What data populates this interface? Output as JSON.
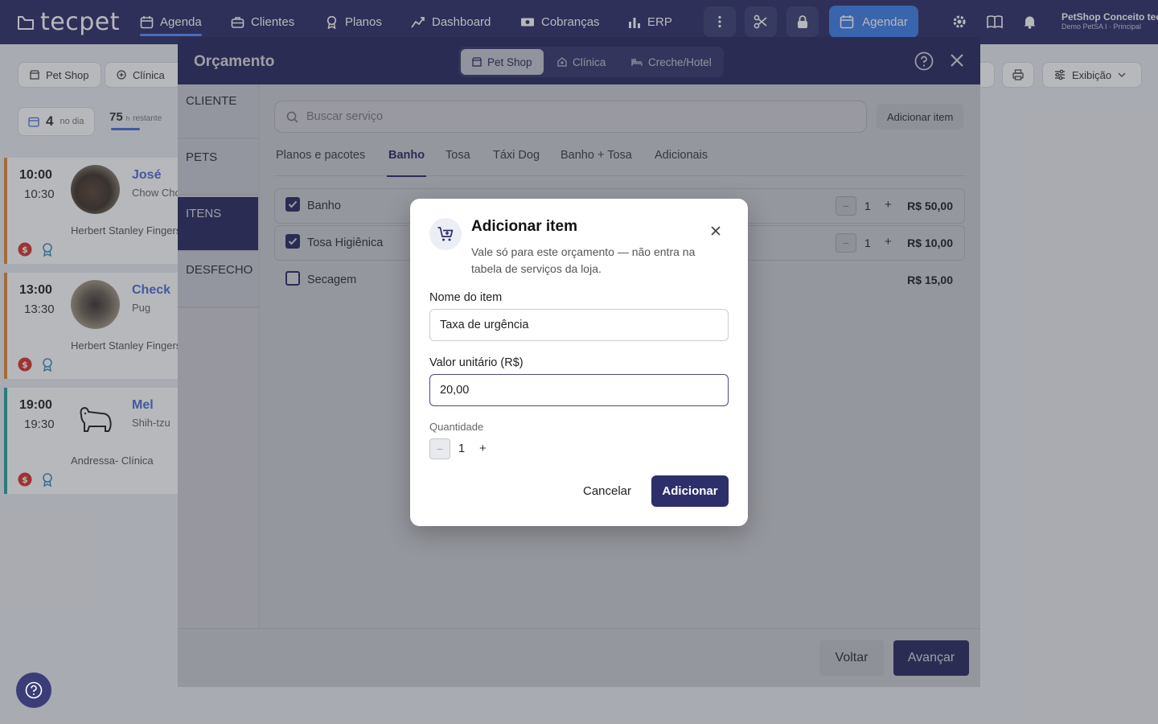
{
  "app": {
    "logo_text": "tecpet",
    "nav": [
      {
        "label": "Agenda",
        "icon": "calendar-icon",
        "active": true
      },
      {
        "label": "Clientes",
        "icon": "briefcase-icon"
      },
      {
        "label": "Planos",
        "icon": "medal-icon"
      },
      {
        "label": "Dashboard",
        "icon": "trend-icon"
      },
      {
        "label": "Cobranças",
        "icon": "money-icon"
      },
      {
        "label": "ERP",
        "icon": "bar-chart-icon"
      }
    ],
    "agendar_label": "Agendar",
    "user_name": "PetShop Conceito tecpet",
    "user_sub": "Demo PetSA I · Principal",
    "accent": "#2d2f6b"
  },
  "background": {
    "filters": {
      "petshop": "Pet Shop",
      "clinica": "Clínica",
      "exibicao": "Exibição"
    },
    "stats": {
      "day_count": "4",
      "day_label": "no dia",
      "remaining_count": "75",
      "remaining_unit": "h",
      "remaining_label": "restante"
    },
    "appointments": [
      {
        "start": "10:00",
        "end": "10:30",
        "pet": "José",
        "breed": "Chow Chow",
        "owner": "Herbert Stanley Fingers",
        "bar_color": "#e08a3c"
      },
      {
        "start": "13:00",
        "end": "13:30",
        "pet": "Check",
        "breed": "Pug",
        "owner": "Herbert Stanley Fingers",
        "bar_color": "#e08a3c"
      },
      {
        "start": "19:00",
        "end": "19:30",
        "pet": "Mel",
        "breed": "Shih-tzu",
        "owner": "Andressa- Clínica",
        "bar_color": "#2aa39a"
      }
    ]
  },
  "orcamento": {
    "title": "Orçamento",
    "segments": [
      {
        "label": "Pet Shop",
        "active": true
      },
      {
        "label": "Clínica"
      },
      {
        "label": "Creche/Hotel"
      }
    ],
    "steps": [
      "CLIENTE",
      "PETS",
      "ITENS",
      "DESFECHO"
    ],
    "active_step": "ITENS",
    "search_placeholder": "Buscar serviço",
    "add_item_label": "Adicionar item",
    "tabs": [
      "Planos e pacotes",
      "Banho",
      "Tosa",
      "Táxi Dog",
      "Banho + Tosa",
      "Adicionais"
    ],
    "active_tab": "Banho",
    "services": [
      {
        "name": "Banho",
        "checked": true,
        "qty": "1",
        "price": "R$ 50,00"
      },
      {
        "name": "Tosa Higiênica",
        "checked": true,
        "qty": "1",
        "price": "R$ 10,00"
      },
      {
        "name": "Secagem",
        "checked": false,
        "price": "R$ 15,00"
      }
    ],
    "back_label": "Voltar",
    "next_label": "Avançar"
  },
  "modal": {
    "title": "Adicionar item",
    "subtitle": "Vale só para este orçamento — não entra na tabela de serviços da loja.",
    "name_label": "Nome do item",
    "name_value": "Taxa de urgência",
    "price_label": "Valor unitário (R$)",
    "price_value": "20,00",
    "qty_label": "Quantidade",
    "qty_value": "1",
    "cancel_label": "Cancelar",
    "add_label": "Adicionar"
  }
}
